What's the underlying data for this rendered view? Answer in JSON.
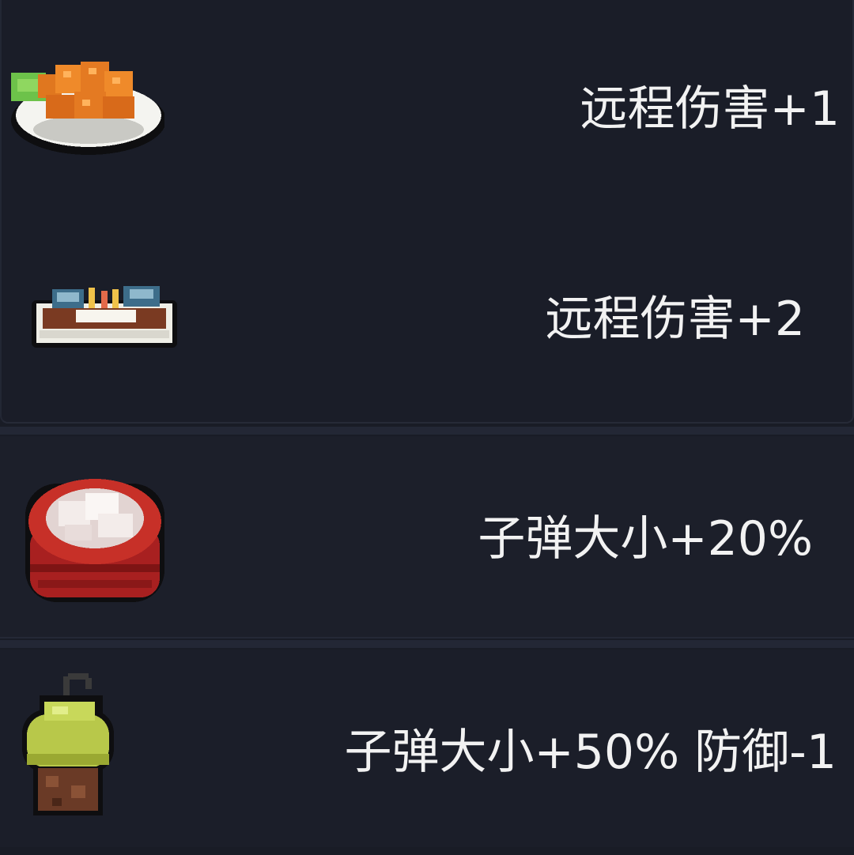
{
  "items": [
    {
      "icon": "fried-chicken-plate-icon",
      "effect": "远程伤害+1"
    },
    {
      "icon": "fish-dish-icon",
      "effect": "远程伤害+2"
    },
    {
      "icon": "dumpling-bucket-icon",
      "effect": "子弹大小+20%"
    },
    {
      "icon": "mushroom-pot-icon",
      "effect": "子弹大小+50% 防御-1"
    }
  ],
  "colors": {
    "background": "#191c26",
    "text": "#f2f2f2"
  }
}
